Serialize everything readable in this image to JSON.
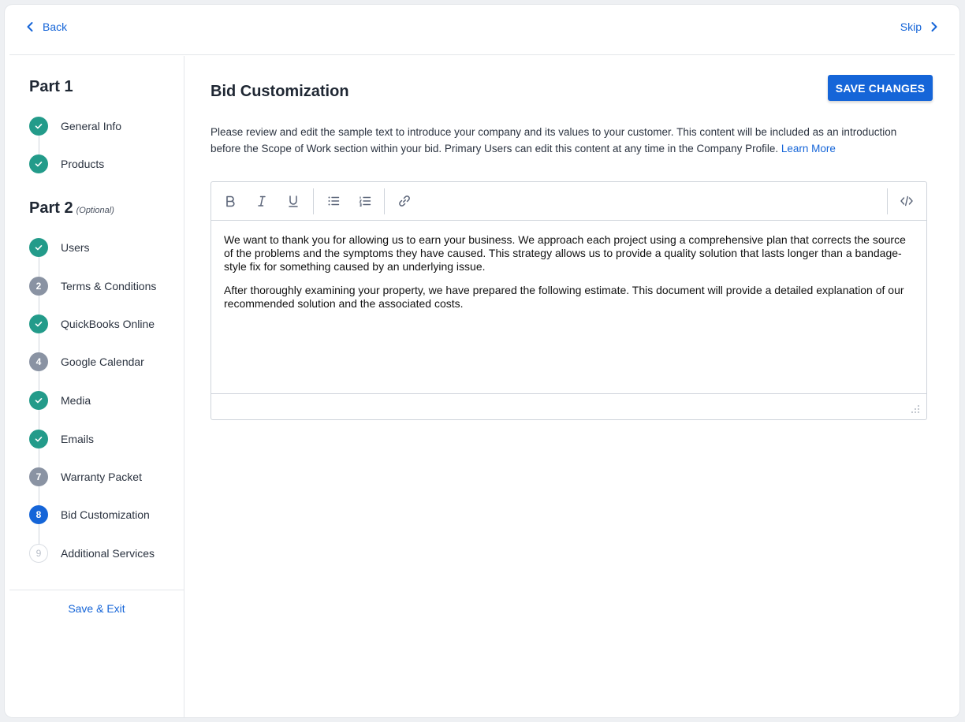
{
  "nav": {
    "back_label": "Back",
    "skip_label": "Skip"
  },
  "sidebar": {
    "part1_title": "Part 1",
    "part2_title": "Part 2",
    "part2_optional": "(Optional)",
    "part1_steps": [
      {
        "label": "General Info",
        "status": "done",
        "marker": ""
      },
      {
        "label": "Products",
        "status": "done",
        "marker": ""
      }
    ],
    "part2_steps": [
      {
        "label": "Users",
        "status": "done",
        "marker": ""
      },
      {
        "label": "Terms & Conditions",
        "status": "todo",
        "marker": "2"
      },
      {
        "label": "QuickBooks Online",
        "status": "done",
        "marker": ""
      },
      {
        "label": "Google Calendar",
        "status": "todo",
        "marker": "4"
      },
      {
        "label": "Media",
        "status": "done",
        "marker": ""
      },
      {
        "label": "Emails",
        "status": "done",
        "marker": ""
      },
      {
        "label": "Warranty Packet",
        "status": "todo",
        "marker": "7"
      },
      {
        "label": "Bid Customization",
        "status": "active",
        "marker": "8"
      },
      {
        "label": "Additional Services",
        "status": "pending",
        "marker": "9"
      }
    ],
    "save_exit_label": "Save & Exit"
  },
  "main": {
    "title": "Bid Customization",
    "save_button_label": "SAVE CHANGES",
    "intro_text": "Please review and edit the sample text to introduce your company and its values to your customer. This content will be included as an introduction before the Scope of Work section within your bid. Primary Users can edit this content at any time in the Company Profile. ",
    "learn_more_label": "Learn More",
    "editor": {
      "toolbar": [
        "bold",
        "italic",
        "underline",
        "bulleted-list",
        "numbered-list",
        "link",
        "source-code"
      ],
      "paragraph1": "We want to thank you for allowing us to earn your business. We approach each project using a comprehensive plan that corrects the source of the problems and the symptoms they have caused. This strategy allows us to provide a quality solution that lasts longer than a bandage-style fix for something caused by an underlying issue.",
      "paragraph2": "After thoroughly examining your property, we have prepared the following estimate. This document will provide a detailed explanation of our recommended solution and the associated costs."
    }
  },
  "colors": {
    "accent": "#1565d8",
    "done": "#239b8a",
    "todo": "#8a93a3"
  }
}
